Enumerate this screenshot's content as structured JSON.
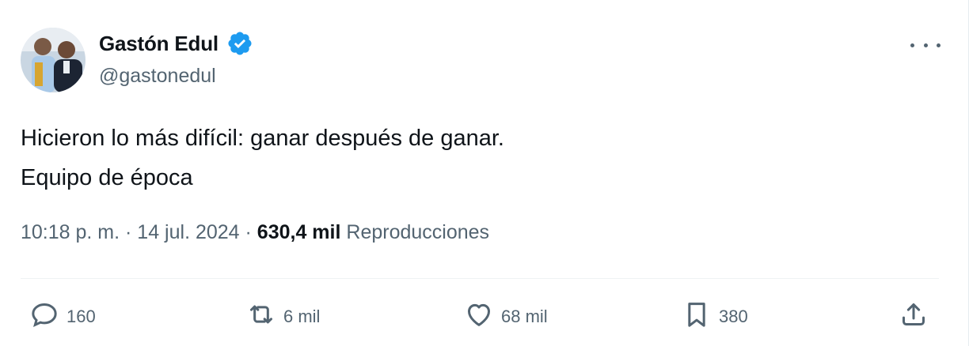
{
  "author": {
    "name": "Gastón Edul",
    "handle": "@gastonedul",
    "verified": true
  },
  "tweet": {
    "lines": [
      "Hicieron lo más difícil: ganar después de ganar.",
      "Equipo de época"
    ]
  },
  "meta": {
    "time": "10:18 p. m.",
    "separator": " · ",
    "date": "14 jul. 2024",
    "views_count": "630,4 mil",
    "views_label": "Reproducciones"
  },
  "actions": {
    "replies": "160",
    "retweets": "6 mil",
    "likes": "68 mil",
    "bookmarks": "380"
  },
  "colors": {
    "verified_blue": "#1d9bf0",
    "secondary_text": "#536471",
    "primary_text": "#0f1419"
  },
  "icons": [
    "more-icon",
    "verified-badge-icon",
    "reply-icon",
    "retweet-icon",
    "like-icon",
    "bookmark-icon",
    "share-icon"
  ]
}
